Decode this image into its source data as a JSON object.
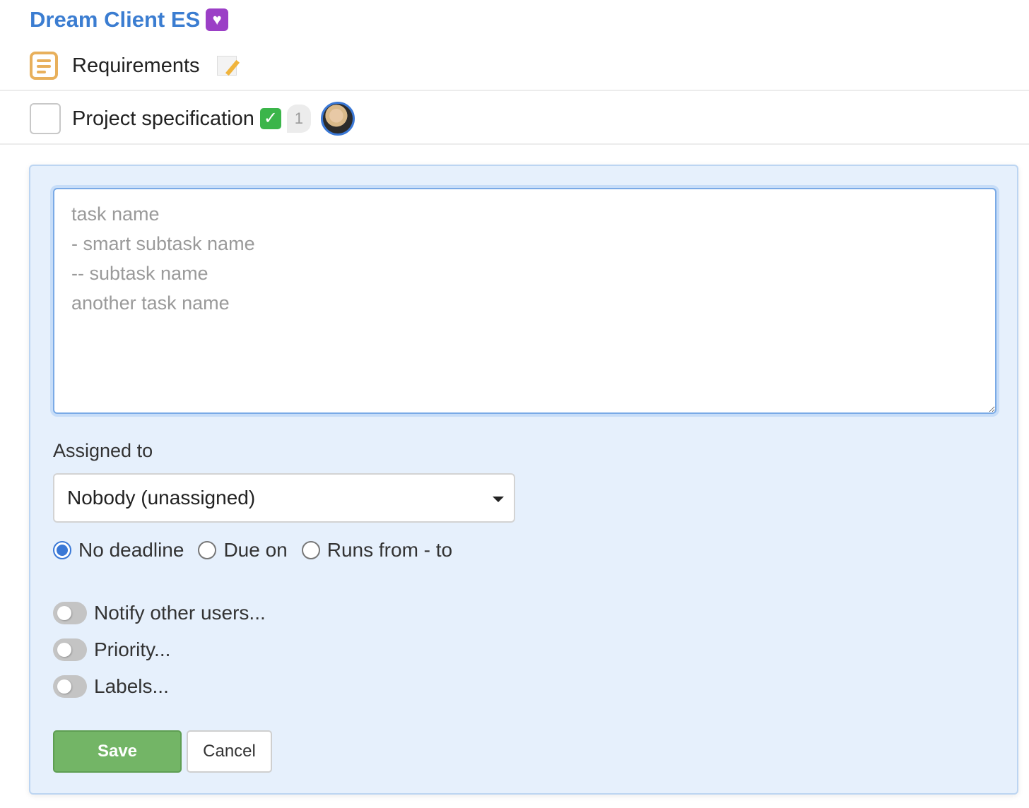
{
  "project": {
    "title": "Dream Client ES",
    "emoji_icon": "purple-heart-icon"
  },
  "list": {
    "name": "Requirements",
    "icon": "list-icon",
    "emoji_icon": "memo-icon"
  },
  "task": {
    "name": "Project specification",
    "checked": false,
    "emoji_icon": "check-mark-button-icon",
    "comment_count": "1",
    "assignee_avatar": "avatar"
  },
  "form": {
    "textarea": {
      "value": "",
      "placeholder": "task name\n- smart subtask name\n-- subtask name\nanother task name"
    },
    "assigned_label": "Assigned to",
    "assigned_value": "Nobody (unassigned)",
    "deadline_options": [
      {
        "label": "No deadline",
        "checked": true
      },
      {
        "label": "Due on",
        "checked": false
      },
      {
        "label": "Runs from - to",
        "checked": false
      }
    ],
    "toggles": [
      {
        "label": "Notify other users...",
        "on": false
      },
      {
        "label": "Priority...",
        "on": false
      },
      {
        "label": "Labels...",
        "on": false
      }
    ],
    "save_label": "Save",
    "cancel_label": "Cancel"
  },
  "colors": {
    "accent": "#3b7dd1",
    "save_green": "#73b566",
    "panel_bg": "#e6f0fc",
    "list_icon": "#e8b05c"
  }
}
